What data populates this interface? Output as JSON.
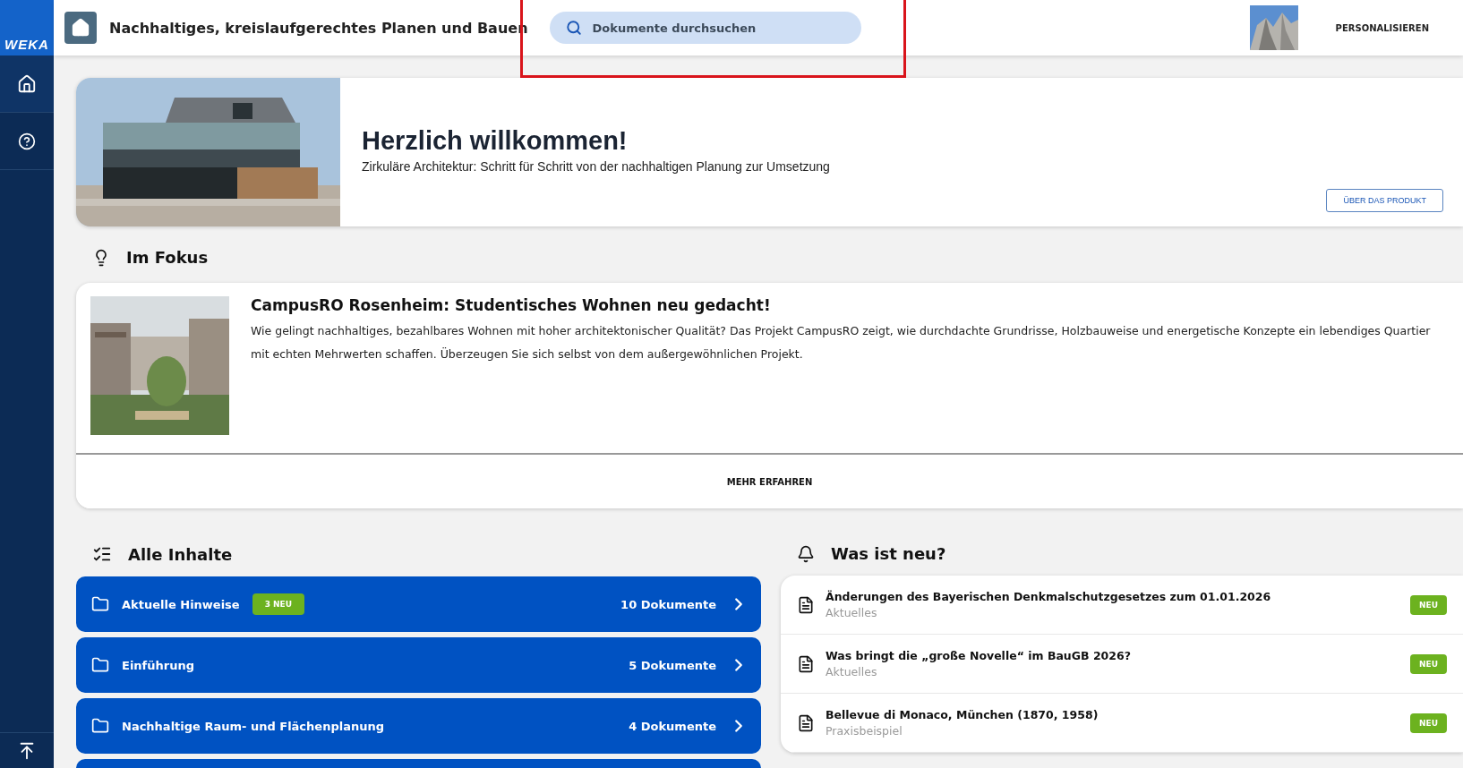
{
  "sidebar": {
    "logo": "WEKA",
    "items": [
      {
        "kind": "home",
        "selected": true
      },
      {
        "kind": "help",
        "selected": false
      }
    ],
    "bottom": {
      "kind": "back-to-top"
    }
  },
  "header": {
    "title": "Nachhaltiges, kreislaufgerechtes Planen und Bauen",
    "search": {
      "placeholder": "Dokumente durchsuchen"
    },
    "personalize": "PERSONALISIEREN"
  },
  "annotation": {
    "kind": "highlight-frame"
  },
  "welcome": {
    "title": "Herzlich willkommen!",
    "subtitle": "Zirkuläre Architektur: Schritt für Schritt von der nachhaltigen Planung zur Umsetzung",
    "button": "ÜBER DAS PRODUKT"
  },
  "focus": {
    "heading": "Im Fokus",
    "title": "CampusRO Rosenheim: Studentisches Wohnen neu gedacht!",
    "text": "Wie gelingt nachhaltiges, bezahlbares Wohnen mit hoher architektonischer Qualität? Das Projekt CampusRO zeigt, wie durchdachte Grundrisse, Holzbauweise und energetische Konzepte ein lebendiges Quartier mit echten Mehrwerten schaffen. Überzeugen Sie sich selbst von dem außergewöhnlichen Projekt.",
    "button": "MEHR ERFAHREN"
  },
  "contents": {
    "heading": "Alle Inhalte",
    "rows": [
      {
        "label": "Aktuelle Hinweise",
        "badge": "3 NEU",
        "count": "10 Dokumente"
      },
      {
        "label": "Einführung",
        "count": "5 Dokumente"
      },
      {
        "label": "Nachhaltige Raum- und Flächenplanung",
        "count": "4 Dokumente"
      }
    ],
    "more_below": true
  },
  "news": {
    "heading": "Was ist neu?",
    "items": [
      {
        "title": "Änderungen des Bayerischen Denkmalschutzgesetzes zum 01.01.2026",
        "category": "Aktuelles",
        "badge": "NEU"
      },
      {
        "title": "Was bringt die „große Novelle“ im BauGB 2026?",
        "category": "Aktuelles",
        "badge": "NEU"
      },
      {
        "title": "Bellevue di Monaco, München (1870, 1958)",
        "category": "Praxisbeispiel",
        "badge": "NEU"
      }
    ]
  }
}
